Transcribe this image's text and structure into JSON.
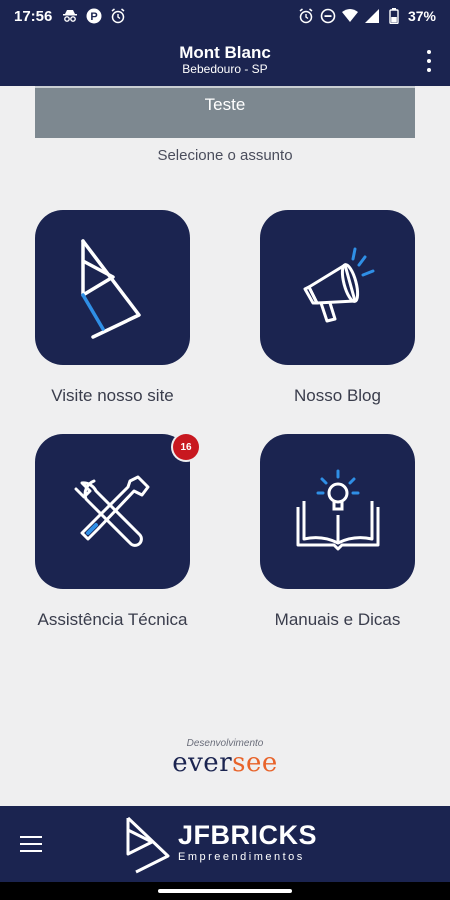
{
  "status": {
    "time": "17:56",
    "battery": "37%"
  },
  "header": {
    "title": "Mont Blanc",
    "subtitle": "Bebedouro - SP"
  },
  "banner": {
    "text": "Teste"
  },
  "prompt": "Selecione o assunto",
  "tiles": [
    {
      "label": "Visite nosso site",
      "icon": "play-logo-icon"
    },
    {
      "label": "Nosso Blog",
      "icon": "megaphone-icon"
    },
    {
      "label": "Assistência Técnica",
      "icon": "tools-icon",
      "badge": "16"
    },
    {
      "label": "Manuais e Dicas",
      "icon": "book-bulb-icon"
    }
  ],
  "developer": {
    "label": "Desenvolvimento",
    "brand_main": "ever",
    "brand_accent": "see"
  },
  "footer": {
    "brand_name": "JFBRICKS",
    "brand_sub": "Empreendimentos"
  },
  "colors": {
    "primary": "#1b2450",
    "accent": "#2f8fe6",
    "badge": "#c81820",
    "background": "#efeff0"
  }
}
